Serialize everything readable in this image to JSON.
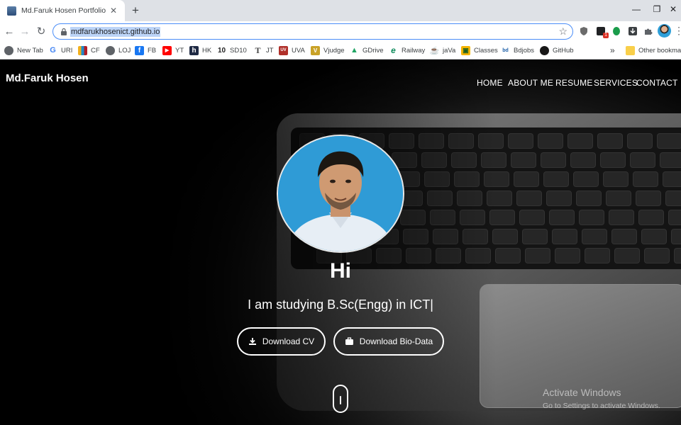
{
  "browser": {
    "tab": {
      "title": "Md.Faruk Hosen Portfolio",
      "close_glyph": "✕",
      "favicon_icon": "profile-favicon"
    },
    "new_tab_glyph": "+",
    "window_controls": {
      "minimize": "—",
      "restore": "❐",
      "close": "✕"
    },
    "nav": {
      "back": "←",
      "forward": "→",
      "reload": "↻"
    },
    "url": "mdfarukhosenict.github.io",
    "star_glyph": "☆",
    "menu_glyph": "⋮",
    "bookmarks": [
      {
        "label": "New Tab",
        "icon": "globe-icon",
        "glyph": "●",
        "color": "#5f6368"
      },
      {
        "label": "URI",
        "icon": "google-icon",
        "glyph": "G",
        "color": "#4285f4"
      },
      {
        "label": "CF",
        "icon": "codeforces-icon",
        "glyph": "▮",
        "color": "#f2b01e"
      },
      {
        "label": "LOJ",
        "icon": "globe-icon",
        "glyph": "●",
        "color": "#5f6368"
      },
      {
        "label": "FB",
        "icon": "facebook-icon",
        "glyph": "f",
        "color": "#1877f2"
      },
      {
        "label": "YT",
        "icon": "youtube-icon",
        "glyph": "▶",
        "color": "#ff0000"
      },
      {
        "label": "HK",
        "icon": "hackerrank-icon",
        "glyph": "h",
        "color": "#1f2a44"
      },
      {
        "label": "SD10",
        "icon": "tenminute-icon",
        "glyph": "10",
        "color": "#222222"
      },
      {
        "label": "JT",
        "icon": "javatpoint-icon",
        "glyph": "T",
        "color": "#444444"
      },
      {
        "label": "UVA",
        "icon": "uva-icon",
        "glyph": "UV",
        "color": "#b0302a"
      },
      {
        "label": "Vjudge",
        "icon": "vjudge-icon",
        "glyph": "V",
        "color": "#c9a227"
      },
      {
        "label": "GDrive",
        "icon": "gdrive-icon",
        "glyph": "▲",
        "color": "#1fa463"
      },
      {
        "label": "Railway",
        "icon": "railway-icon",
        "glyph": "e",
        "color": "#0c8a5a"
      },
      {
        "label": "jaVa",
        "icon": "java-icon",
        "glyph": "☕",
        "color": "#e76f00"
      },
      {
        "label": "Classes",
        "icon": "classroom-icon",
        "glyph": "▣",
        "color": "#f4b400"
      },
      {
        "label": "Bdjobs",
        "icon": "bdjobs-icon",
        "glyph": "bd",
        "color": "#1d5fa8"
      },
      {
        "label": "GitHub",
        "icon": "github-icon",
        "glyph": "●",
        "color": "#181717"
      }
    ],
    "bookmarks_overflow": "»",
    "other_bookmarks": "Other bookmarks"
  },
  "site": {
    "brand": "Md.Faruk Hosen",
    "menu": [
      "HOME",
      "ABOUT ME",
      "RESUME",
      "SERVICES",
      "CONTACT"
    ],
    "greeting": "Hi",
    "tagline": "I am studying B.Sc(Engg) in ICT|",
    "buttons": {
      "cv": {
        "label": "Download CV",
        "icon": "download-icon"
      },
      "biodata": {
        "label": "Download Bio-Data",
        "icon": "briefcase-icon"
      }
    },
    "scroll_icon": "mouse-scroll-icon"
  },
  "windows_watermark": {
    "title": "Activate Windows",
    "subtitle": "Go to Settings to activate Windows."
  }
}
